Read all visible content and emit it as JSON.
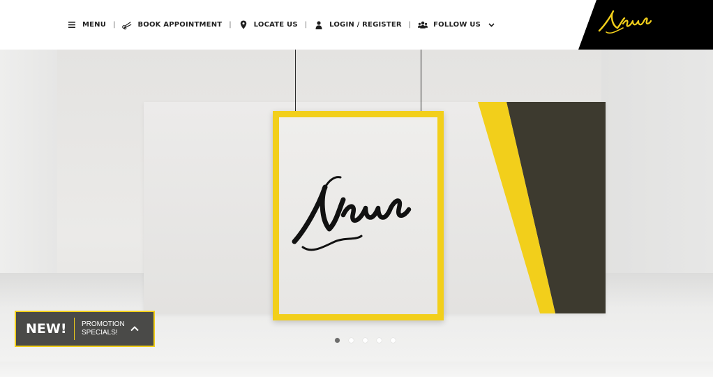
{
  "header": {
    "nav": [
      {
        "key": "menu",
        "label": "MENU",
        "icon": "hamburger-icon"
      },
      {
        "key": "book",
        "label": "BOOK APPOINTMENT",
        "icon": "scissors-icon"
      },
      {
        "key": "locate",
        "label": "LOCATE US",
        "icon": "map-pin-icon"
      },
      {
        "key": "login",
        "label": "LOGIN / REGISTER",
        "icon": "user-icon"
      },
      {
        "key": "follow",
        "label": "FOLLOW US",
        "icon": "users-icon"
      }
    ],
    "logo_text": "Neue"
  },
  "hero": {
    "brand_text": "Neue",
    "slide_count": 5,
    "active_slide": 1
  },
  "promo": {
    "badge": "NEW!",
    "text": "PROMOTION SPECIALS!"
  },
  "colors": {
    "accent": "#f2cf1b",
    "dark_panel": "#3d3a2f",
    "promo_bg": "#4a4a48",
    "header_bg": "#ffffff",
    "logo_bg": "#000000"
  }
}
